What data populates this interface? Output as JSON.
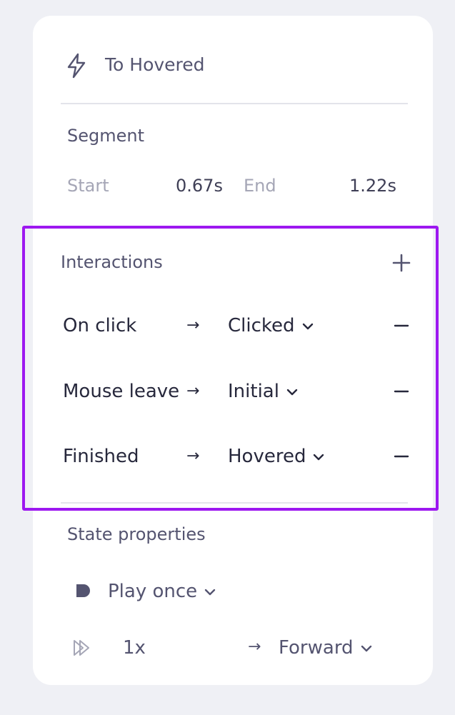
{
  "header": {
    "title": "To Hovered",
    "icon": "lightning-icon"
  },
  "segment": {
    "heading": "Segment",
    "start_label": "Start",
    "start_value": "0.67s",
    "end_label": "End",
    "end_value": "1.22s"
  },
  "interactions": {
    "heading": "Interactions",
    "add_icon": "plus-icon",
    "rows": [
      {
        "trigger": "On click",
        "arrow": "→",
        "target": "Clicked"
      },
      {
        "trigger": "Mouse leave",
        "arrow": "→",
        "target": "Initial"
      },
      {
        "trigger": "Finished",
        "arrow": "→",
        "target": "Hovered"
      }
    ]
  },
  "state_properties": {
    "heading": "State properties",
    "playback_mode": "Play once",
    "speed": "1x",
    "direction_arrow": "→",
    "direction": "Forward"
  },
  "colors": {
    "background": "#eff0f5",
    "card": "#ffffff",
    "highlight": "#9d18f0",
    "text_primary": "#27283c",
    "text_secondary": "#545470",
    "text_muted": "#a5a6b6"
  }
}
